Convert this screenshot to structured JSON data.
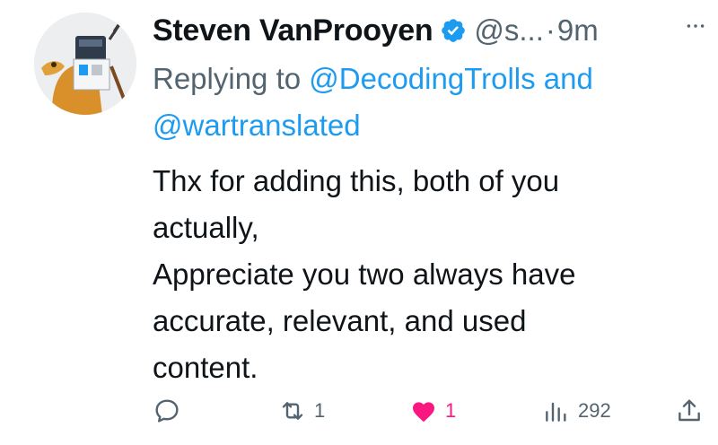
{
  "author": {
    "name": "Steven VanProoyen",
    "handle": "@s...",
    "separator": "·",
    "time": "9m"
  },
  "reply": {
    "prefix": "Replying to ",
    "mention1": "@DecodingTrolls",
    "conjunction": " and",
    "mention2": "@wartranslated"
  },
  "tweet": {
    "lines": [
      "Thx for adding this, both of you",
      "actually,",
      "Appreciate you two always have",
      "accurate, relevant, and used",
      "content."
    ]
  },
  "actions": {
    "reply_icon": "reply-icon",
    "retweet_count": "1",
    "like_count": "1",
    "views_count": "292"
  },
  "colors": {
    "text": "#0f1419",
    "muted": "#536471",
    "link": "#1d9bf0",
    "like": "#f91880",
    "verified": "#1d9bf0"
  }
}
